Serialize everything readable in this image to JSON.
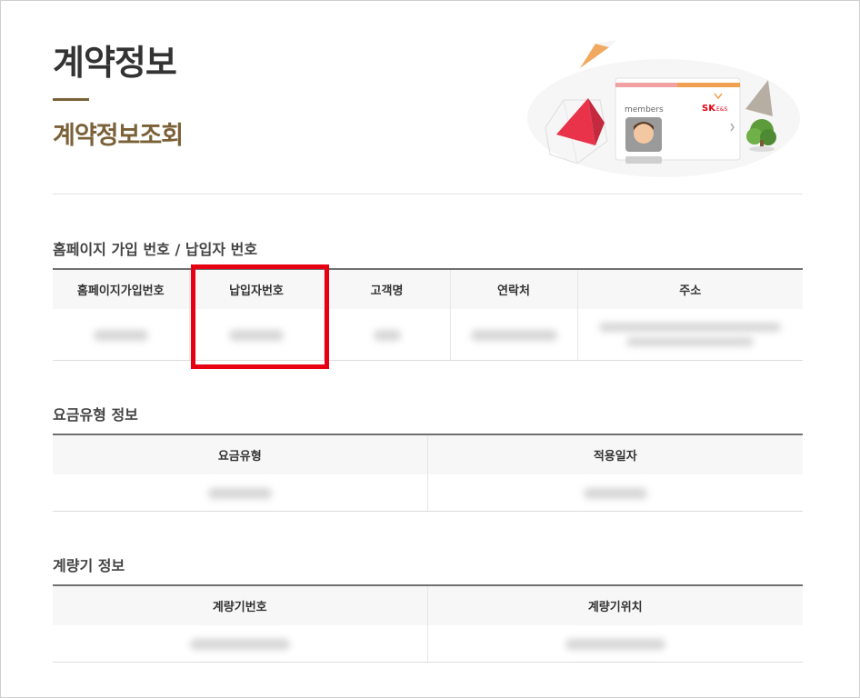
{
  "page": {
    "title": "계약정보",
    "subtitle": "계약정보조회"
  },
  "banner": {
    "card_label": "members",
    "brand": "SK",
    "brand_sub": "E&S"
  },
  "sections": {
    "member": {
      "title": "홈페이지 가입 번호 / 납입자 번호",
      "columns": [
        "홈페이지가입번호",
        "납입자번호",
        "고객명",
        "연락처",
        "주소"
      ]
    },
    "rate": {
      "title": "요금유형 정보",
      "columns": [
        "요금유형",
        "적용일자"
      ]
    },
    "meter": {
      "title": "계량기 정보",
      "columns": [
        "계량기번호",
        "계량기위치"
      ]
    }
  },
  "colors": {
    "accent_brown": "#7a6138",
    "highlight_red": "#e60012",
    "table_rule": "#707070"
  }
}
